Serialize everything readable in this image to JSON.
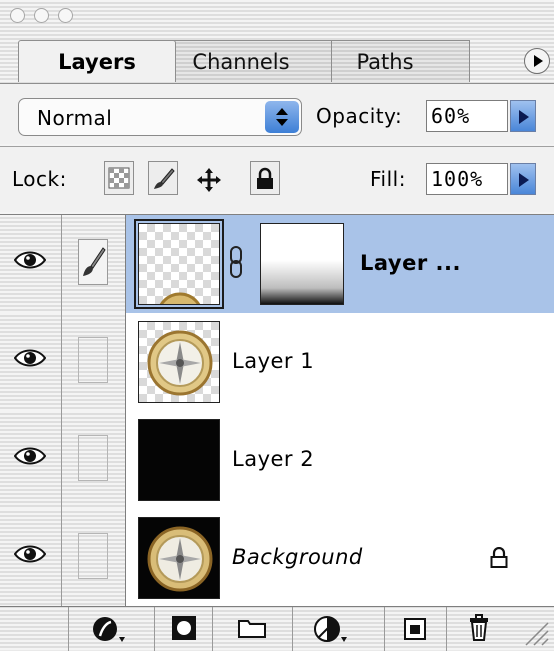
{
  "window": {
    "buttons": [
      "close",
      "minimize",
      "zoom"
    ]
  },
  "tabs": [
    {
      "label": "Layers",
      "active": true
    },
    {
      "label": "Channels",
      "active": false
    },
    {
      "label": "Paths",
      "active": false
    }
  ],
  "controls": {
    "blend_mode": "Normal",
    "opacity_label": "Opacity:",
    "opacity_value": "60%",
    "lock_label": "Lock:",
    "fill_label": "Fill:",
    "fill_value": "100%"
  },
  "layers": [
    {
      "name": "Layer ...",
      "visible": true,
      "selected": true,
      "has_mask": true,
      "locked": false,
      "thumb": "transparent-with-compass"
    },
    {
      "name": "Layer 1",
      "visible": true,
      "selected": false,
      "has_mask": false,
      "locked": false,
      "thumb": "compass"
    },
    {
      "name": "Layer 2",
      "visible": true,
      "selected": false,
      "has_mask": false,
      "locked": false,
      "thumb": "black"
    },
    {
      "name": "Background",
      "visible": true,
      "selected": false,
      "has_mask": false,
      "locked": true,
      "thumb": "compass-on-black"
    }
  ],
  "toolbar": {
    "buttons": [
      "layer-style",
      "layer-mask",
      "new-set",
      "new-fill-adjustment",
      "new-layer",
      "delete-layer"
    ]
  },
  "colors": {
    "selection": "#a9c3e8",
    "accent_blue": "#3d7fd6"
  }
}
